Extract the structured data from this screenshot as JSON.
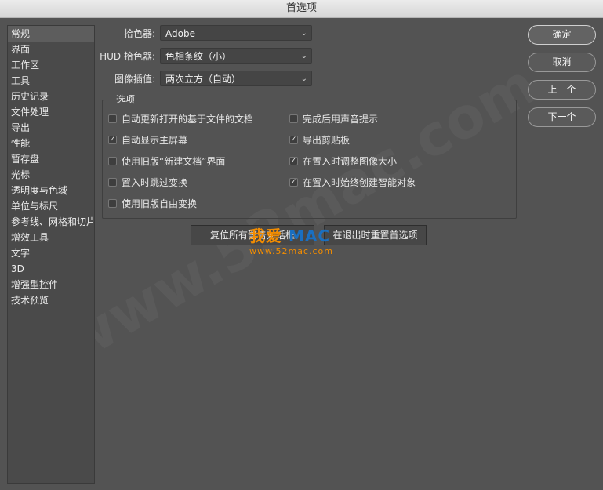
{
  "window": {
    "title": "首选项"
  },
  "sidebar": {
    "items": [
      {
        "label": "常规",
        "active": true
      },
      {
        "label": "界面"
      },
      {
        "label": "工作区"
      },
      {
        "label": "工具"
      },
      {
        "label": "历史记录"
      },
      {
        "label": "文件处理"
      },
      {
        "label": "导出"
      },
      {
        "label": "性能"
      },
      {
        "label": "暂存盘"
      },
      {
        "label": "光标"
      },
      {
        "label": "透明度与色域"
      },
      {
        "label": "单位与标尺"
      },
      {
        "label": "参考线、网格和切片"
      },
      {
        "label": "增效工具"
      },
      {
        "label": "文字"
      },
      {
        "label": "3D"
      },
      {
        "label": "增强型控件"
      },
      {
        "label": "技术预览"
      }
    ]
  },
  "form": {
    "color_picker": {
      "label": "拾色器:",
      "value": "Adobe"
    },
    "hud_color_picker": {
      "label": "HUD 拾色器:",
      "value": "色相条纹（小）"
    },
    "image_interpolation": {
      "label": "图像插值:",
      "value": "两次立方（自动）"
    }
  },
  "options": {
    "title": "选项",
    "left": [
      {
        "label": "自动更新打开的基于文件的文档",
        "checked": false
      },
      {
        "label": "自动显示主屏幕",
        "checked": true
      },
      {
        "label": "使用旧版“新建文档”界面",
        "checked": false
      },
      {
        "label": "置入时跳过变换",
        "checked": false
      },
      {
        "label": "使用旧版自由变换",
        "checked": false
      }
    ],
    "right": [
      {
        "label": "完成后用声音提示",
        "checked": false
      },
      {
        "label": "导出剪贴板",
        "checked": true
      },
      {
        "label": "在置入时调整图像大小",
        "checked": true
      },
      {
        "label": "在置入时始终创建智能对象",
        "checked": true
      }
    ]
  },
  "buttons": {
    "reset_warnings": "复位所有警告对话框",
    "reset_prefs_on_quit": "在退出时重置首选项",
    "ok": "确定",
    "cancel": "取消",
    "prev": "上一个",
    "next": "下一个"
  },
  "watermark": {
    "brand_cn": "我爱",
    "brand_mac": "MAC",
    "url": "www.52mac.com",
    "diagonal": "www.52mac.com"
  }
}
